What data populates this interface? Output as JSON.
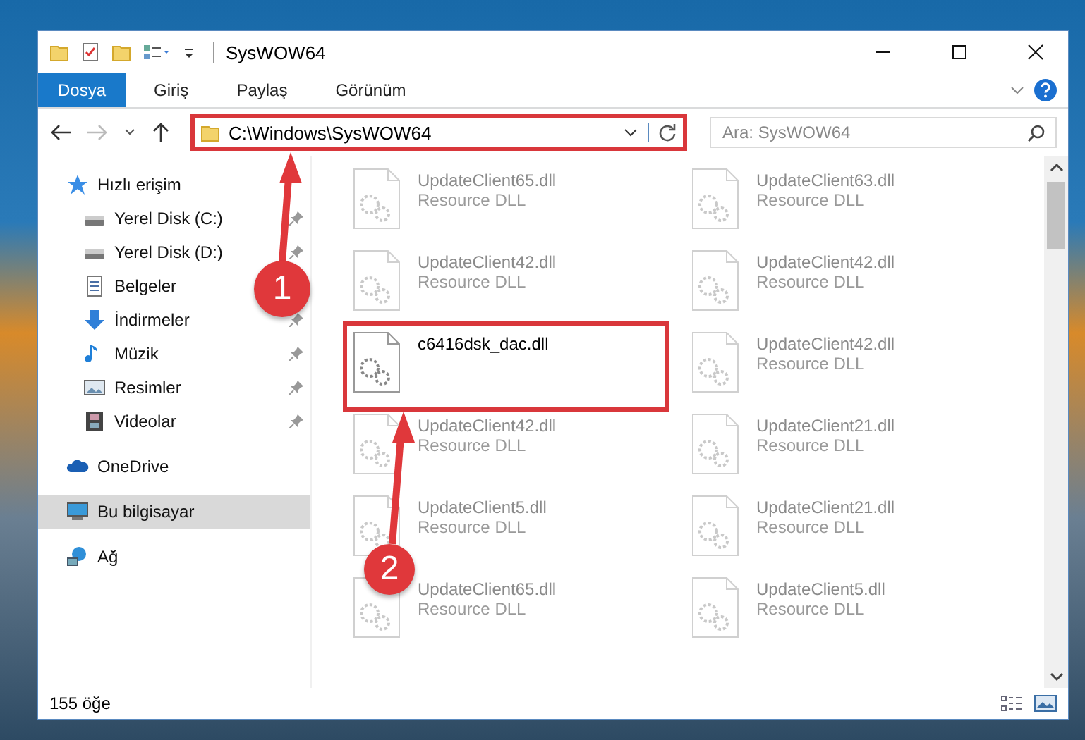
{
  "window": {
    "title": "SysWOW64"
  },
  "ribbon_tabs": [
    {
      "label": "Dosya",
      "selected": true
    },
    {
      "label": "Giriş",
      "selected": false
    },
    {
      "label": "Paylaş",
      "selected": false
    },
    {
      "label": "Görünüm",
      "selected": false
    }
  ],
  "address_bar": {
    "path": "C:\\Windows\\SysWOW64",
    "highlighted": true
  },
  "search": {
    "placeholder": "Ara: SysWOW64"
  },
  "sidebar": {
    "items": [
      {
        "label": "Hızlı erişim",
        "kind": "star",
        "selected": false,
        "pinned": false,
        "children": [
          {
            "label": "Yerel Disk (C:)",
            "kind": "drive",
            "selected": false,
            "pinned": true
          },
          {
            "label": "Yerel Disk (D:)",
            "kind": "drive",
            "selected": false,
            "pinned": true
          },
          {
            "label": "Belgeler",
            "kind": "document",
            "selected": false,
            "pinned": false
          },
          {
            "label": "İndirmeler",
            "kind": "download",
            "selected": false,
            "pinned": true
          },
          {
            "label": "Müzik",
            "kind": "music",
            "selected": false,
            "pinned": true
          },
          {
            "label": "Resimler",
            "kind": "picture",
            "selected": false,
            "pinned": true
          },
          {
            "label": "Videolar",
            "kind": "video",
            "selected": false,
            "pinned": true
          }
        ]
      },
      {
        "label": "OneDrive",
        "kind": "cloud",
        "selected": false,
        "pinned": false
      },
      {
        "label": "Bu bilgisayar",
        "kind": "computer",
        "selected": true,
        "pinned": false
      },
      {
        "label": "Ağ",
        "kind": "network",
        "selected": false,
        "pinned": false
      }
    ]
  },
  "files": [
    {
      "name": "UpdateClient65.dll",
      "type": "Resource DLL",
      "blurred": true,
      "highlighted": false
    },
    {
      "name": "UpdateClient63.dll",
      "type": "Resource DLL",
      "blurred": true,
      "highlighted": false
    },
    {
      "name": "UpdateClient42.dll",
      "type": "Resource DLL",
      "blurred": true,
      "highlighted": false
    },
    {
      "name": "UpdateClient42.dll",
      "type": "Resource DLL",
      "blurred": true,
      "highlighted": false
    },
    {
      "name": "c6416dsk_dac.dll",
      "blurred": false,
      "highlighted": true
    },
    {
      "name": "UpdateClient42.dll",
      "type": "Resource DLL",
      "blurred": true,
      "highlighted": false
    },
    {
      "name": "UpdateClient42.dll",
      "type": "Resource DLL",
      "blurred": true,
      "highlighted": false
    },
    {
      "name": "UpdateClient21.dll",
      "type": "Resource DLL",
      "blurred": true,
      "highlighted": false
    },
    {
      "name": "UpdateClient5.dll",
      "type": "Resource DLL",
      "blurred": true,
      "highlighted": false
    },
    {
      "name": "UpdateClient21.dll",
      "type": "Resource DLL",
      "blurred": true,
      "highlighted": false
    },
    {
      "name": "UpdateClient65.dll",
      "type": "Resource DLL",
      "blurred": true,
      "highlighted": false
    },
    {
      "name": "UpdateClient5.dll",
      "type": "Resource DLL",
      "blurred": true,
      "highlighted": false
    }
  ],
  "status_bar": {
    "item_count": "155 öğe"
  },
  "annotations": [
    {
      "label": "1"
    },
    {
      "label": "2"
    }
  ]
}
